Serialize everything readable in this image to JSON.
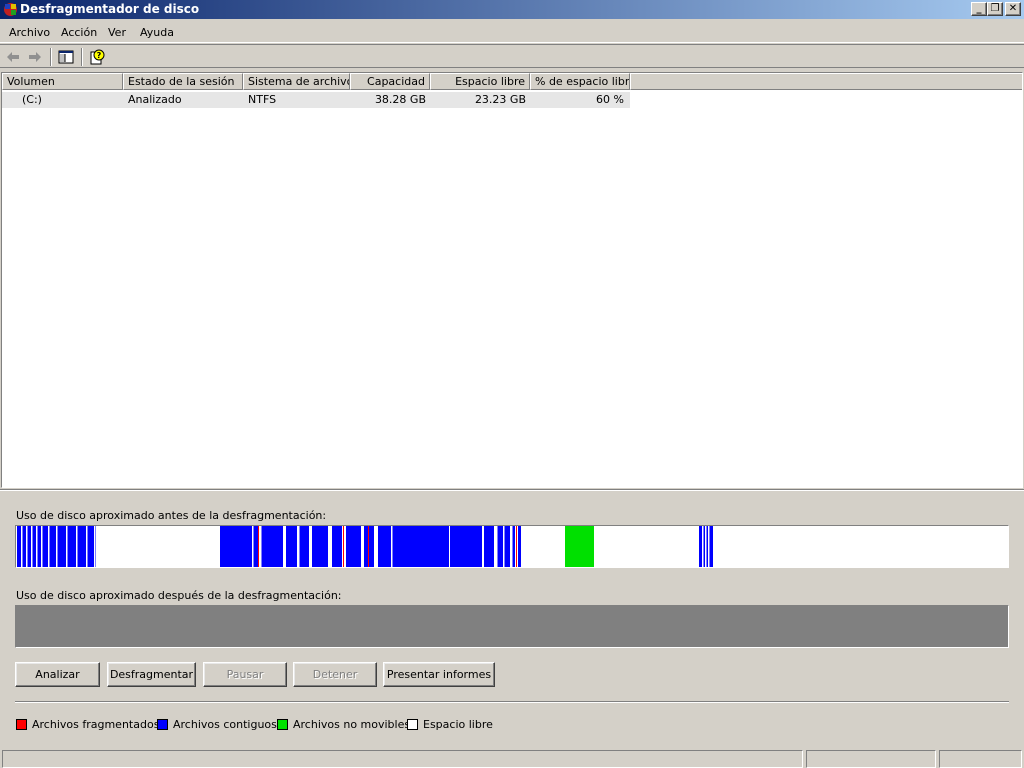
{
  "window": {
    "title": "Desfragmentador de disco",
    "icon": "defrag-app-icon",
    "controls": {
      "minimize": "_",
      "maximize": "❐",
      "close": "✕"
    }
  },
  "menu": [
    "Archivo",
    "Acción",
    "Ver",
    "Ayuda"
  ],
  "toolbar": {
    "items": [
      "back-arrow-icon",
      "forward-arrow-icon",
      "show-hide-console-tree-icon",
      "help-icon"
    ]
  },
  "volumes": {
    "columns": [
      "Volumen",
      "Estado de la sesión",
      "Sistema de archivos",
      "Capacidad",
      "Espacio libre",
      "% de espacio libre"
    ],
    "rows": [
      {
        "volume": "(C:)",
        "status": "Analizado",
        "filesystem": "NTFS",
        "capacity": "38.28 GB",
        "free": "23.23 GB",
        "free_pct": "60 %"
      }
    ]
  },
  "before_label": "Uso de disco aproximado antes de la desfragmentación:",
  "after_label": "Uso de disco aproximado después de la desfragmentación:",
  "colors": {
    "fragmented": "#ff0000",
    "contiguous": "#0000ff",
    "unmovable": "#00e000",
    "free": "#ffffff"
  },
  "buttons": {
    "analyze": "Analizar",
    "defragment": "Desfragmentar",
    "pause": "Pausar",
    "stop": "Detener",
    "report": "Presentar informes"
  },
  "legend": {
    "fragmented": "Archivos fragmentados",
    "contiguous": "Archivos contiguos",
    "unmovable": "Archivos no movibles",
    "free": "Espacio libre"
  }
}
